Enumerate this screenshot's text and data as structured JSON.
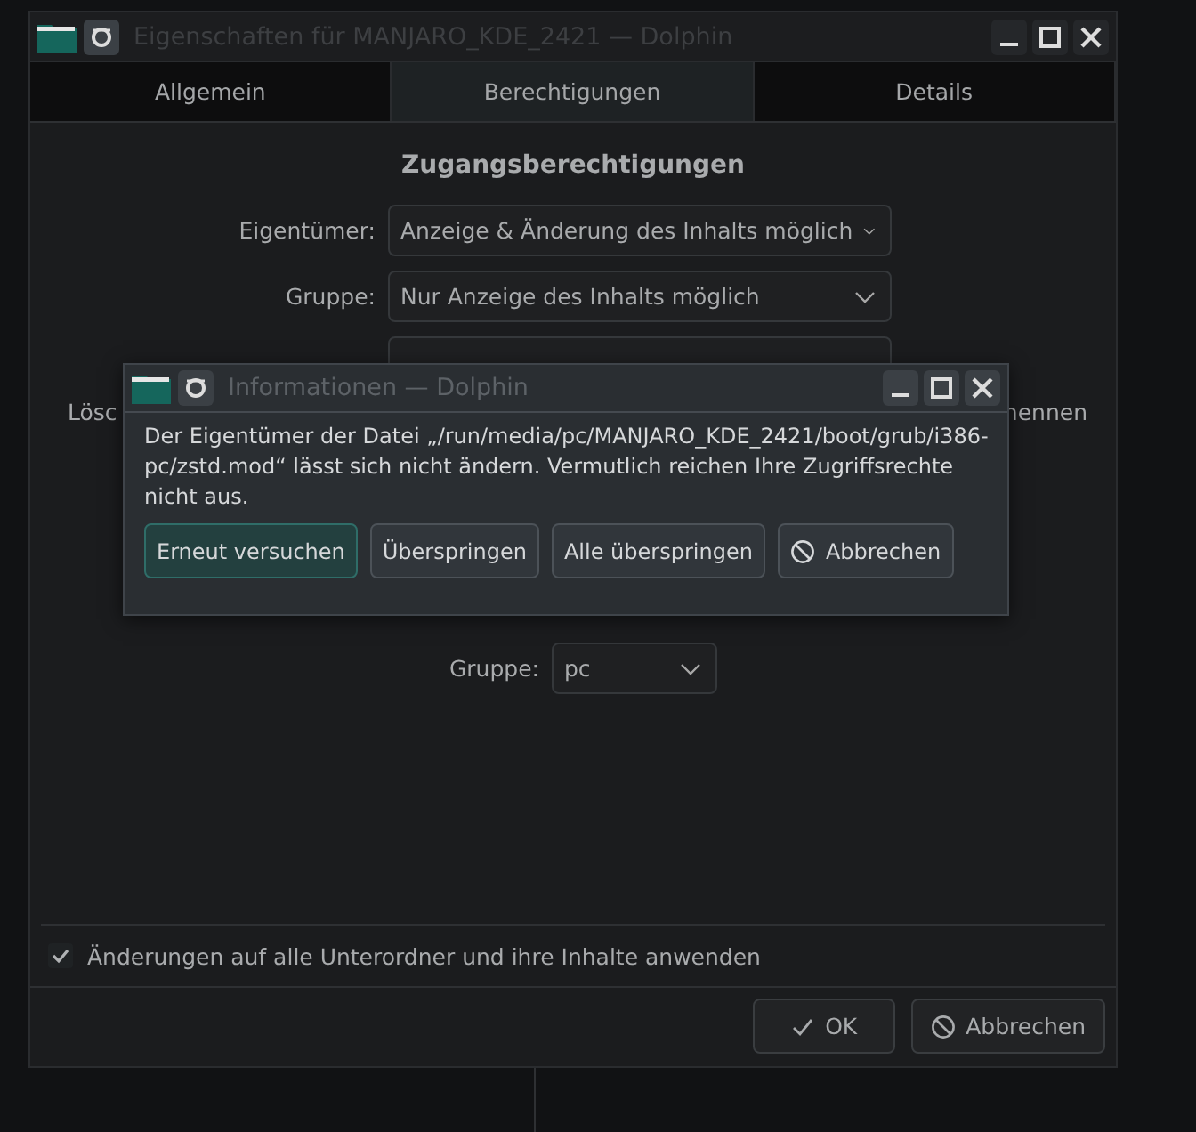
{
  "window": {
    "title": "Eigenschaften für MANJARO_KDE_2421 — Dolphin"
  },
  "tabs": [
    {
      "label": "Allgemein",
      "selected": false
    },
    {
      "label": "Berechtigungen",
      "selected": true
    },
    {
      "label": "Details",
      "selected": false
    }
  ],
  "section_title": "Zugangsberechtigungen",
  "permissions": [
    {
      "label": "Eigentümer:",
      "value": "Anzeige & Änderung des Inhalts möglich"
    },
    {
      "label": "Gruppe:",
      "value": "Nur Anzeige des Inhalts möglich"
    }
  ],
  "partial_row": {
    "left": "Lösc",
    "right": "nennen"
  },
  "ownership": {
    "group_label": "Gruppe:",
    "group": "pc"
  },
  "recursive": {
    "label": "Änderungen auf alle Unterordner und ihre Inhalte anwenden",
    "checked": true
  },
  "buttons": [
    {
      "label": "OK",
      "kind": "confirm"
    },
    {
      "label": "Abbrechen",
      "kind": "cancel"
    }
  ],
  "message_dialog": {
    "title": "Informationen — Dolphin",
    "message": "Der Eigentümer der Datei „/run/media/pc/MANJARO_KDE_2421/boot/grub/i386-pc/zstd.mod“ lässt sich nicht ändern. Vermutlich reichen Ihre Zugriffsrechte nicht aus.",
    "buttons": [
      {
        "label": "Erneut versuchen",
        "default": true,
        "kind": "plain"
      },
      {
        "label": "Überspringen",
        "default": false,
        "kind": "plain"
      },
      {
        "label": "Alle überspringen",
        "default": false,
        "kind": "plain"
      },
      {
        "label": "Abbrechen",
        "default": false,
        "kind": "cancel"
      }
    ]
  }
}
